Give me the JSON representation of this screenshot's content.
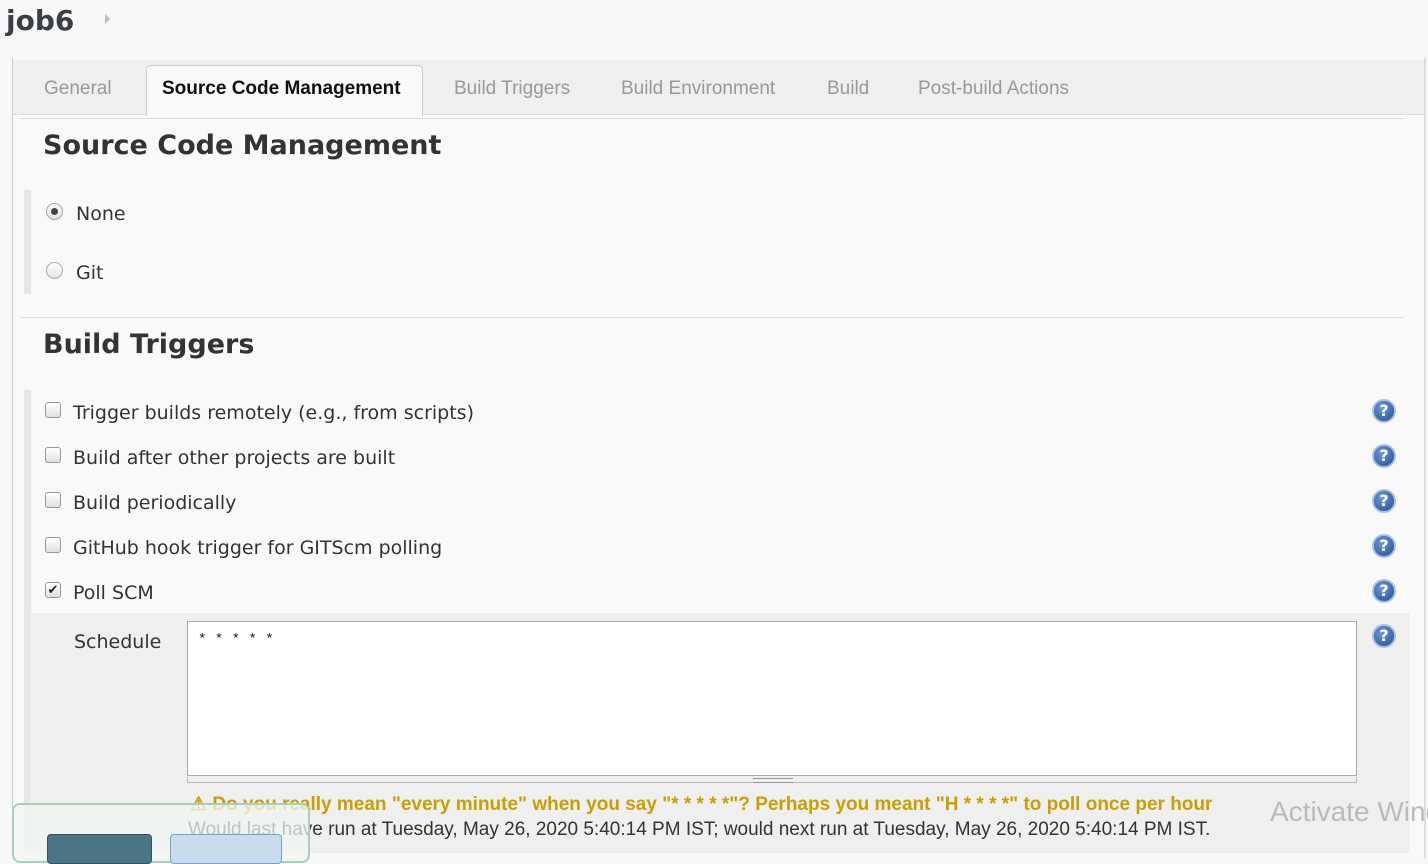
{
  "header": {
    "job_name": "job6"
  },
  "tabs": [
    "General",
    "Source Code Management",
    "Build Triggers",
    "Build Environment",
    "Build",
    "Post-build Actions"
  ],
  "scm": {
    "title": "Source Code Management",
    "options": [
      {
        "label": "None",
        "selected": true
      },
      {
        "label": "Git",
        "selected": false
      }
    ]
  },
  "triggers": {
    "title": "Build Triggers",
    "items": [
      {
        "label": "Trigger builds remotely (e.g., from scripts)",
        "checked": false
      },
      {
        "label": "Build after other projects are built",
        "checked": false
      },
      {
        "label": "Build periodically",
        "checked": false
      },
      {
        "label": "GitHub hook trigger for GITScm polling",
        "checked": false
      },
      {
        "label": "Poll SCM",
        "checked": true
      }
    ],
    "schedule_label": "Schedule",
    "schedule_value": "* * * * *",
    "warning": "Do you really mean \"every minute\" when you say \"* * * * *\"? Perhaps you meant \"H * * * *\" to poll once per hour",
    "info": "Would last have run at Tuesday, May 26, 2020 5:40:14 PM IST; would next run at Tuesday, May 26, 2020 5:40:14 PM IST."
  },
  "watermark": "Activate Windows",
  "colors": {
    "warning": "#c9a000",
    "save": "#4b7583",
    "apply": "#c8dcee"
  }
}
